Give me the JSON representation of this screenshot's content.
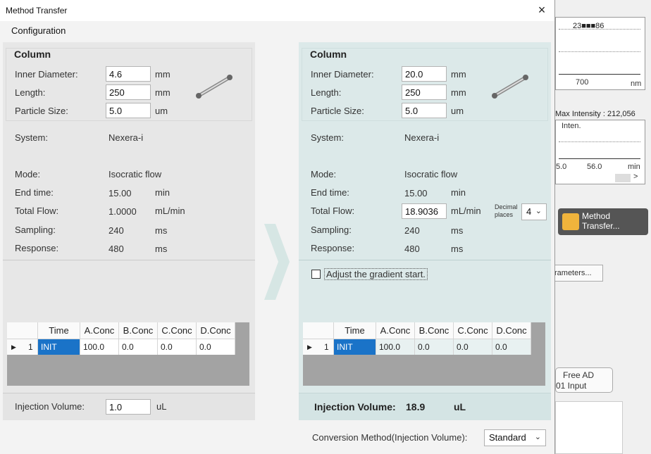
{
  "window": {
    "title": "Method Transfer",
    "close": "×"
  },
  "menu": {
    "configuration": "Configuration"
  },
  "labels": {
    "column": "Column",
    "inner_diameter": "Inner Diameter:",
    "length": "Length:",
    "particle_size": "Particle Size:",
    "system": "System:",
    "mode": "Mode:",
    "end_time": "End time:",
    "total_flow": "Total Flow:",
    "sampling": "Sampling:",
    "response": "Response:",
    "injection_volume": "Injection Volume:"
  },
  "units": {
    "mm": "mm",
    "um": "um",
    "min": "min",
    "flow": "mL/min",
    "ms": "ms",
    "ul": "uL"
  },
  "source": {
    "inner_diameter": "4.6",
    "length": "250",
    "particle_size": "5.0",
    "system": "Nexera-i",
    "mode": "Isocratic flow",
    "end_time": "15.00",
    "total_flow": "1.0000",
    "sampling": "240",
    "response": "480",
    "injection_volume": "1.0"
  },
  "target": {
    "inner_diameter": "20.0",
    "length": "250",
    "particle_size": "5.0",
    "system": "Nexera-i",
    "mode": "Isocratic flow",
    "end_time": "15.00",
    "total_flow": "18.9036",
    "sampling": "240",
    "response": "480",
    "injection_volume": "18.9",
    "decimal_places_label_1": "Decimal",
    "decimal_places_label_2": "places",
    "decimal_places": "4",
    "adjust_gradient": "Adjust the gradient start.",
    "adjust_gradient_checked": false,
    "conversion_label": "Conversion Method(Injection Volume):",
    "conversion_value": "Standard"
  },
  "table": {
    "headers": [
      "Time",
      "A.Conc",
      "B.Conc",
      "C.Conc",
      "D.Conc"
    ],
    "rows": [
      {
        "marker": "▶",
        "index": "1",
        "cells": [
          "INIT",
          "100.0",
          "0.0",
          "0.0",
          "0.0"
        ]
      }
    ]
  },
  "background_app": {
    "spectrum_label": "23■■■86",
    "axis_700": "700",
    "axis_nm": "nm",
    "max_intensity": "Max Intensity : 212,056",
    "inten": "Inten.",
    "axis_left": "5.0",
    "axis_56": "56.0",
    "axis_min": "min",
    "method_transfer_button_1": "Method",
    "method_transfer_button_2": "Transfer...",
    "parameters_button": "rameters...",
    "free_ad_1": "Free AD",
    "free_ad_2": "01 Input"
  },
  "colors": {
    "accent_selected": "#1a73c8",
    "target_panel": "#dce9e9",
    "source_panel": "#e7e7e7"
  }
}
